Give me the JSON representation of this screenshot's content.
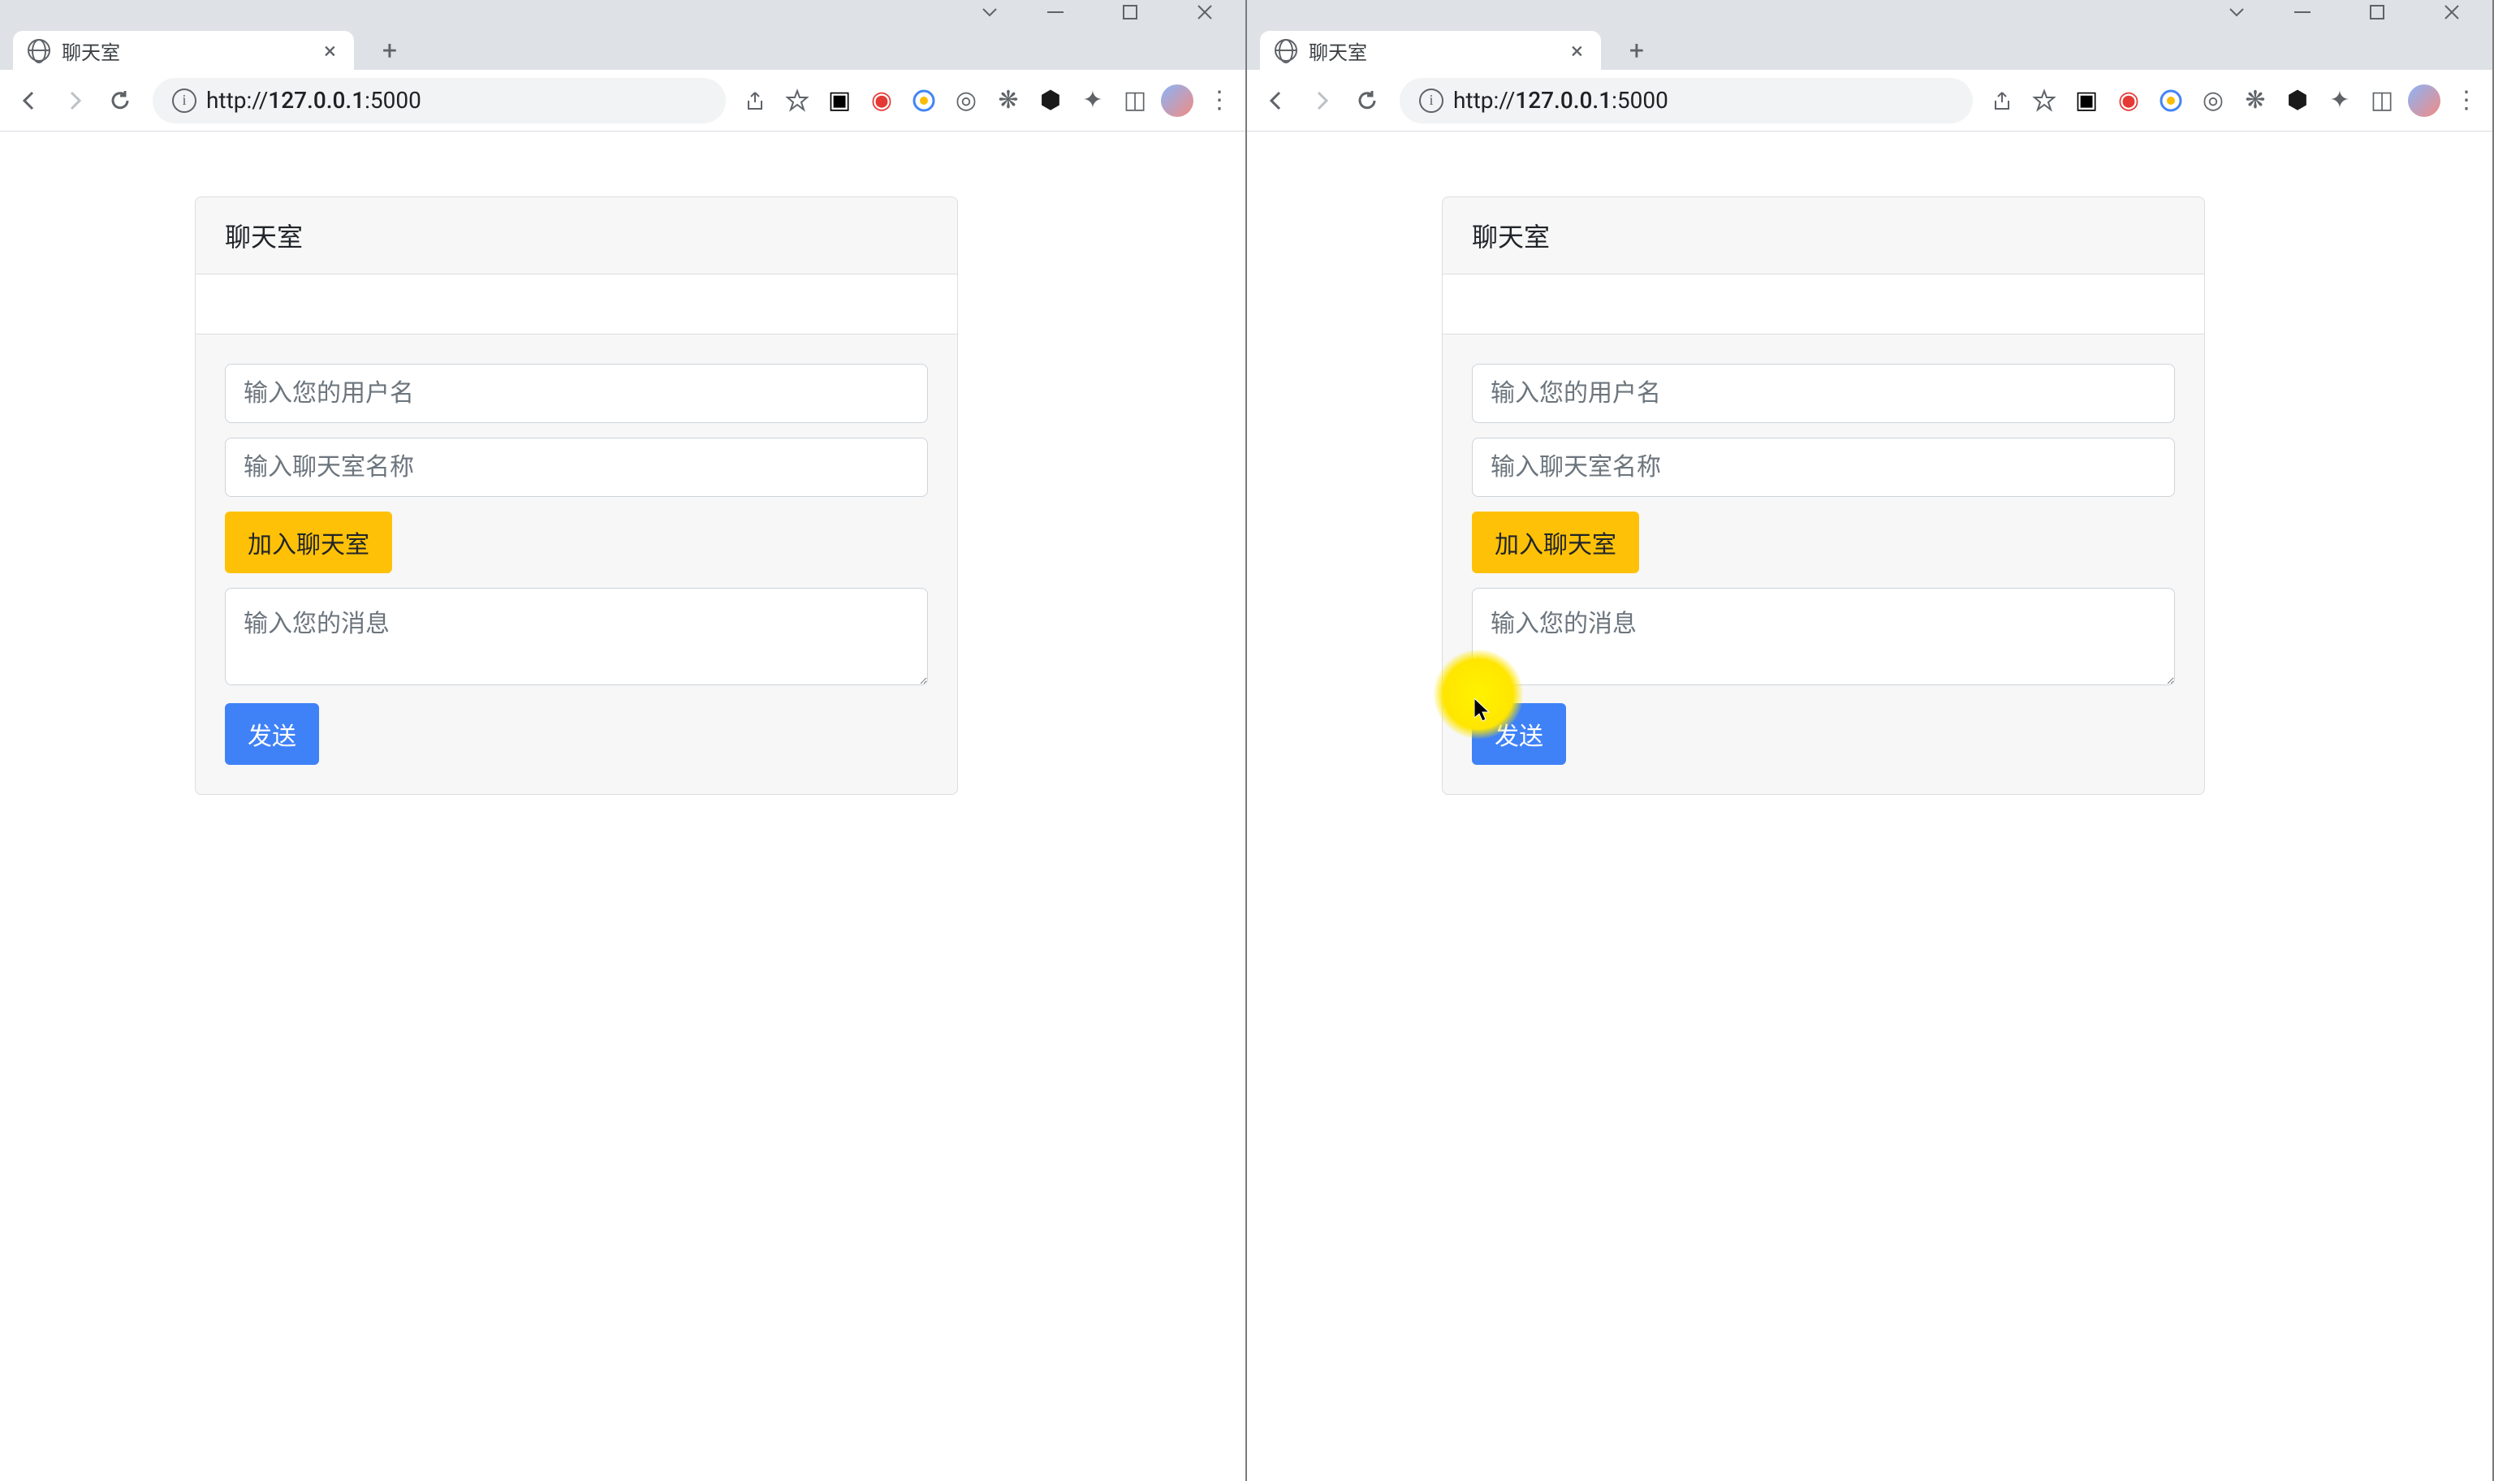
{
  "windows": [
    {
      "tab_title": "聊天室",
      "url_prefix": "http://",
      "url_host": "127.0.0.1",
      "url_port": ":5000"
    },
    {
      "tab_title": "聊天室",
      "url_prefix": "http://",
      "url_host": "127.0.0.1",
      "url_port": ":5000"
    }
  ],
  "app": {
    "card_title": "聊天室",
    "username_placeholder": "输入您的用户名",
    "roomname_placeholder": "输入聊天室名称",
    "join_button_label": "加入聊天室",
    "message_placeholder": "输入您的消息",
    "send_button_label": "发送"
  },
  "toolbar_icons": {
    "share_label": "share-icon",
    "star_label": "star-icon"
  }
}
